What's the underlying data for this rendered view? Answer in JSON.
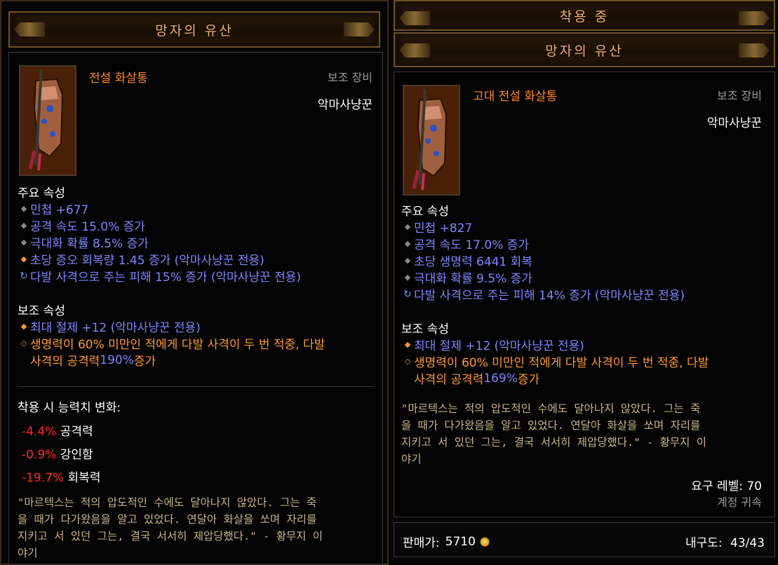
{
  "left": {
    "title": "망자의 유산",
    "rarity": "전설 화살통",
    "slot": "보조 장비",
    "class": "악마사냥꾼",
    "primary_label": "주요 속성",
    "primary": [
      "민첩 +677",
      "공격 속도 15.0% 증가",
      "극대화 확률 8.5% 증가",
      "초당 증오 회복량 1.45 증가 (악마사냥꾼 전용)",
      "다발 사격으로 주는 피해 15% 증가 (악마사냥꾼 전용)"
    ],
    "secondary_label": "보조 속성",
    "secondary": [
      "최대 절제 +12 (악마사냥꾼 전용)",
      "생명력이 60% 미만인 적에게 다발 사격이 두 번 적중, 다발",
      "사격의 공격력 190% 증가"
    ],
    "changes_label": "착용 시 능력치 변화:",
    "changes": [
      {
        "value": "-4.4%",
        "label": "공격력"
      },
      {
        "value": "-0.9%",
        "label": "강인함"
      },
      {
        "value": "-19.7%",
        "label": "회복력"
      }
    ],
    "quote": [
      "\"마르텍스는 적의 압도적인 수에도 달아나지 않았다. 그는 죽",
      "을 때가 다가왔음을 알고 있었다. 연달아 화살을 쏘며 자리를",
      "지키고 서 있던 그는, 결국 서서히 제압당했다.\" - 황무지 이",
      "야기"
    ]
  },
  "right": {
    "equipped": "착용 중",
    "title": "망자의 유산",
    "rarity": "고대 전설 화살통",
    "slot": "보조 장비",
    "class": "악마사냥꾼",
    "primary_label": "주요 속성",
    "primary": [
      "민첩 +827",
      "공격 속도 17.0% 증가",
      "초당 생명력 6441 회복",
      "극대화 확률 9.5% 증가",
      "다발 사격으로 주는 피해 14% 증가 (악마사냥꾼 전용)"
    ],
    "secondary_label": "보조 속성",
    "secondary": [
      "최대 절제 +12 (악마사냥꾼 전용)",
      "생명력이 60% 미만인 적에게 다발 사격이 두 번 적중, 다발",
      "사격의 공격력 169% 증가"
    ],
    "quote": [
      "\"마르텍스는 적의 압도적인 수에도 달아나지 않았다. 그는 죽",
      "을 때가 다가왔음을 알고 있었다. 연달아 화살을 쏘며 자리를",
      "지키고 서 있던 그는, 결국 서서히 제압당했다.\" - 황무지 이",
      "야기"
    ],
    "required_level": "요구 레벨: 70",
    "bound": "계정 귀속",
    "sell_label": "판매가:",
    "sell_value": "5710",
    "durability_label": "내구도:",
    "durability_value": "43/43"
  }
}
